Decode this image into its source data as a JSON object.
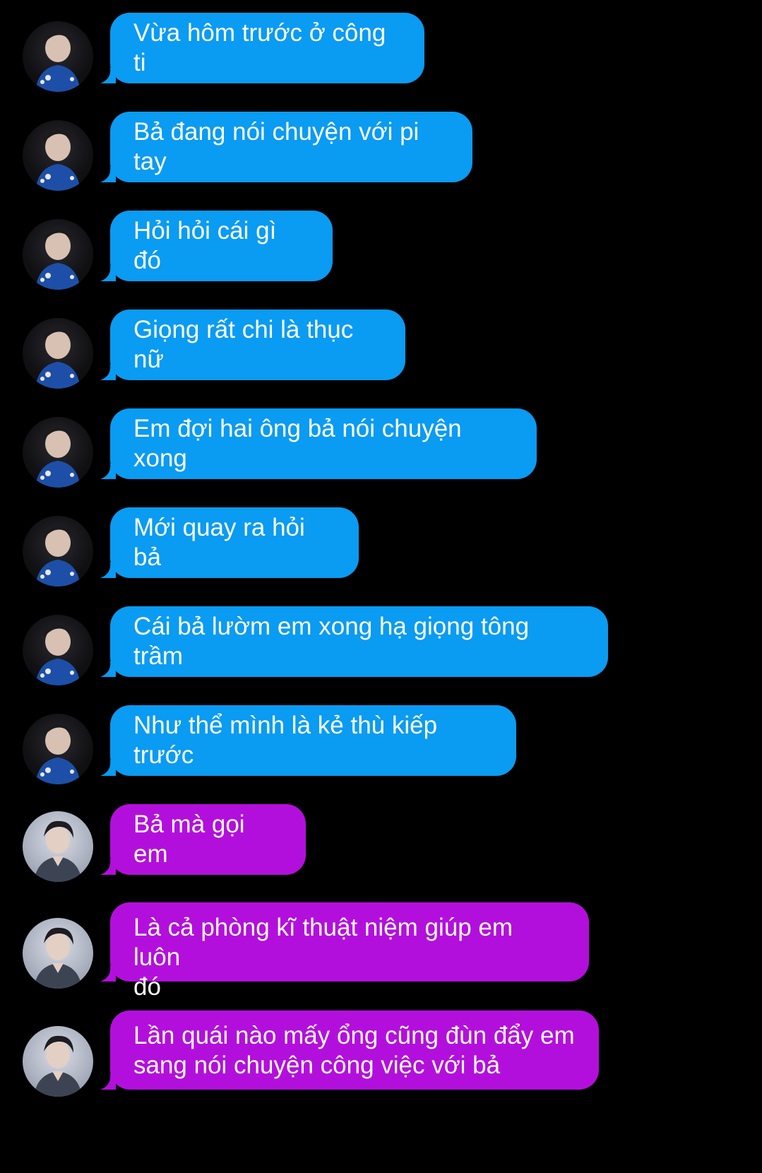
{
  "conversation": {
    "colors": {
      "background": "#000000",
      "incoming_blue": "#0a9bf2",
      "incoming_purple": "#b30fdc",
      "text": "#ffffff"
    },
    "messages": [
      {
        "sender": "a",
        "avatar": "avatar-a",
        "color": "blue",
        "text": "Vừa hôm trước ở công ti"
      },
      {
        "sender": "a",
        "avatar": "avatar-a",
        "color": "blue",
        "text": "Bả đang nói chuyện với pi tay"
      },
      {
        "sender": "a",
        "avatar": "avatar-a",
        "color": "blue",
        "text": "Hỏi hỏi cái gì đó"
      },
      {
        "sender": "a",
        "avatar": "avatar-a",
        "color": "blue",
        "text": "Giọng rất chi là thục nữ"
      },
      {
        "sender": "a",
        "avatar": "avatar-a",
        "color": "blue",
        "text": "Em đợi hai ông bả nói chuyện xong"
      },
      {
        "sender": "a",
        "avatar": "avatar-a",
        "color": "blue",
        "text": "Mới quay ra hỏi bả"
      },
      {
        "sender": "a",
        "avatar": "avatar-a",
        "color": "blue",
        "text": "Cái bả lườm em xong hạ giọng tông trầm"
      },
      {
        "sender": "a",
        "avatar": "avatar-a",
        "color": "blue",
        "text": "Như thể mình là kẻ thù kiếp trước"
      },
      {
        "sender": "b",
        "avatar": "avatar-b",
        "color": "purple",
        "text": "Bả mà gọi em"
      },
      {
        "sender": "b",
        "avatar": "avatar-b",
        "color": "purple",
        "text": "Là cả phòng kĩ thuật niệm giúp em luôn\nđó"
      },
      {
        "sender": "b",
        "avatar": "avatar-b",
        "color": "purple",
        "text": "Lần quái nào mấy ổng cũng đùn đẩy em\nsang nói chuyện công việc với bả"
      }
    ]
  }
}
